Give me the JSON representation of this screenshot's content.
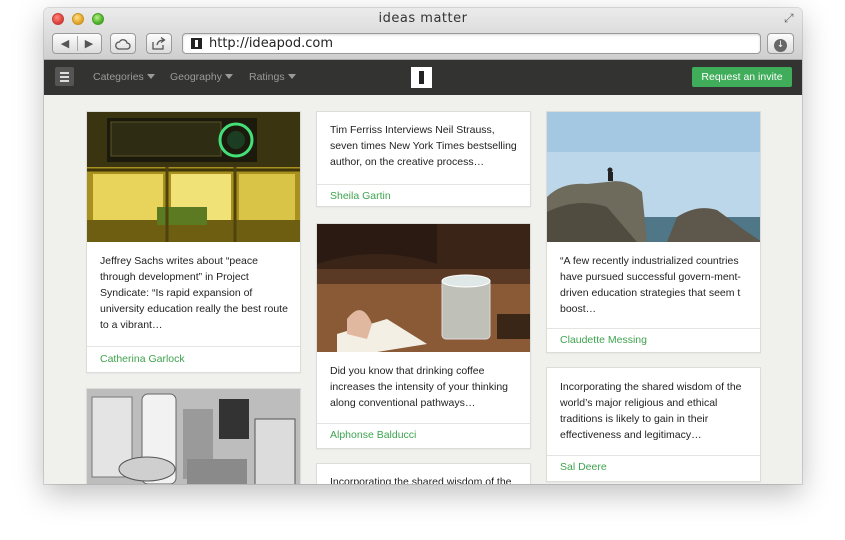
{
  "window": {
    "title": "ideas matter",
    "url": "http://ideapod.com"
  },
  "nav": {
    "items": [
      {
        "label": "Categories"
      },
      {
        "label": "Geography"
      },
      {
        "label": "Ratings"
      }
    ],
    "invite_label": "Request an invite"
  },
  "cards": [
    {
      "text": "Jeffrey Sachs writes about “peace through development” in Project Syndicate: “Is rapid expansion of university education really the best route to a vibrant…",
      "author": "Catherina Garlock",
      "photo": "subway train interior"
    },
    {
      "text": "",
      "author": "",
      "photo": "laboratory equipment"
    },
    {
      "text": "Tim Ferriss Interviews Neil Strauss, seven times New York Times bestselling author, on the creative process…",
      "author": "Sheila Gartin"
    },
    {
      "text": "Did you know that drinking coffee increases the intensity of your thinking along conventional pathways…",
      "author": "Alphonse Balducci",
      "photo": "writing with glass of water"
    },
    {
      "text": "Incorporating the shared wisdom of the",
      "author": ""
    },
    {
      "text": "“A few recently industrialized countries have pursued successful govern-ment-driven education strategies that seem t boost…",
      "author": "Claudette Messing",
      "photo": "person sitting on rocks by the sea"
    },
    {
      "text": "Incorporating the shared wisdom of the world’s major religious and ethical traditions is likely to gain in their effectiveness and legitimacy…",
      "author": "Sal Deere"
    }
  ],
  "colors": {
    "accent": "#3fad5a",
    "nav_bg": "#333332",
    "author": "#3fa34f"
  }
}
